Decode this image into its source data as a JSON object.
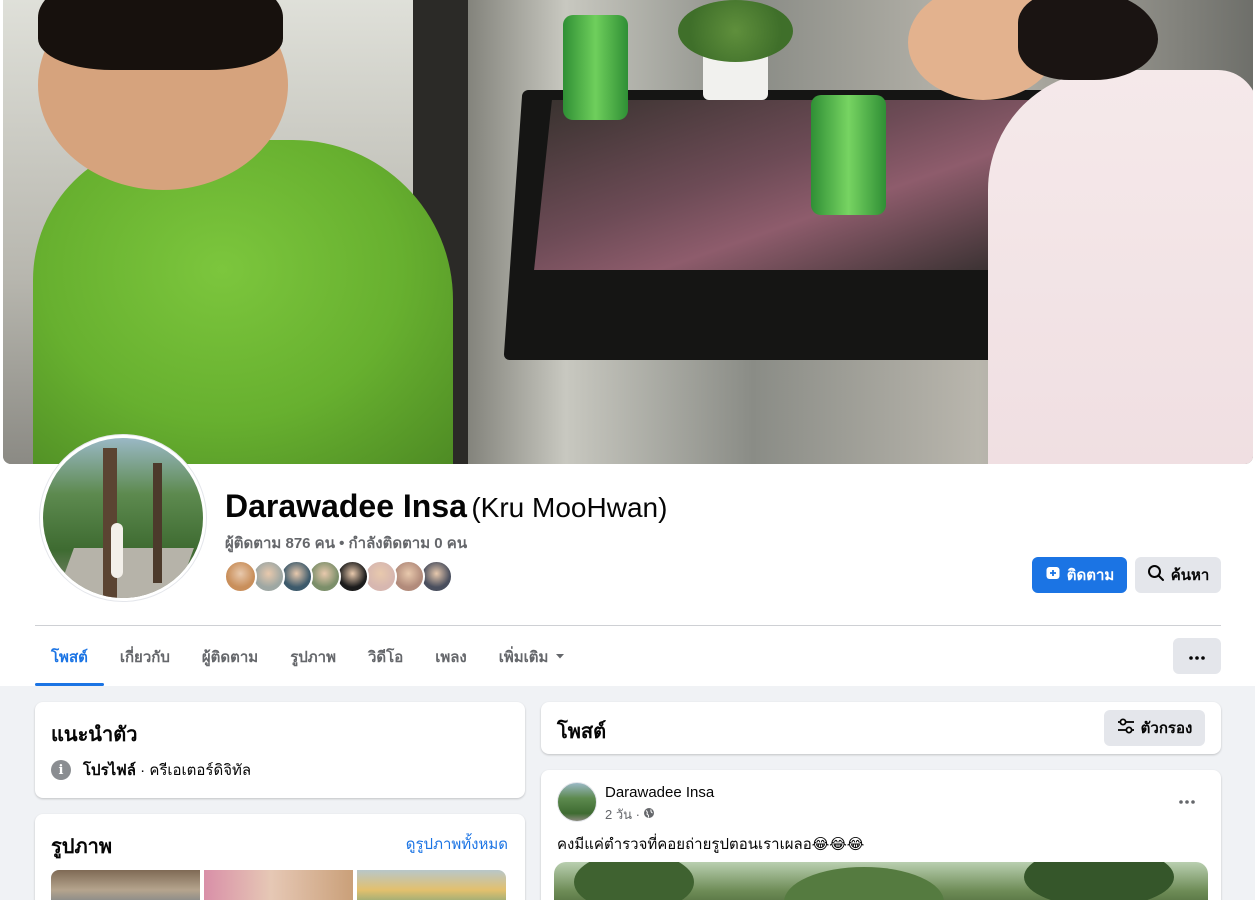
{
  "profile": {
    "name": "Darawadee Insa",
    "nickname": "(Kru MooHwan)",
    "follow_stats": "ผู้ติดตาม 876 คน • กำลังติดตาม 0 คน",
    "follower_avatar_colors": [
      "#c98f5b",
      "#9ea7a3",
      "#3d5a6b",
      "#7c8f6a",
      "#1c1c1c",
      "#d7b7b0",
      "#b28b7b",
      "#4a4f5e"
    ]
  },
  "actions": {
    "follow_label": "ติดตาม",
    "search_label": "ค้นหา"
  },
  "tabs": [
    {
      "label": "โพสต์",
      "active": true
    },
    {
      "label": "เกี่ยวกับ",
      "active": false
    },
    {
      "label": "ผู้ติดตาม",
      "active": false
    },
    {
      "label": "รูปภาพ",
      "active": false
    },
    {
      "label": "วิดีโอ",
      "active": false
    },
    {
      "label": "เพลง",
      "active": false
    },
    {
      "label": "เพิ่มเติม",
      "active": false,
      "dropdown": true
    }
  ],
  "intro": {
    "title": "แนะนำตัว",
    "profile_label": "โปรไฟล์",
    "category": " · ครีเอเตอร์ดิจิทัล"
  },
  "photos": {
    "title": "รูปภาพ",
    "see_all": "ดูรูปภาพทั้งหมด"
  },
  "posts": {
    "title": "โพสต์",
    "filter_label": "ตัวกรอง"
  },
  "post": {
    "author": "Darawadee Insa",
    "time": "2 วัน ·",
    "text": "คงมีแค่ตำรวจที่คอยถ่ายรูปตอนเราเผลอ😂😂😂"
  },
  "colors": {
    "accent": "#1b74e4",
    "secondary_button": "#e4e6eb",
    "page_background": "#f0f2f5",
    "muted_text": "#65676b"
  },
  "icons": {
    "follow": "follow-plus-icon",
    "search": "search-icon",
    "more": "more-dots-icon",
    "dropdown": "caret-down-icon",
    "info": "info-icon",
    "filter": "filter-sliders-icon",
    "privacy": "globe-icon"
  }
}
